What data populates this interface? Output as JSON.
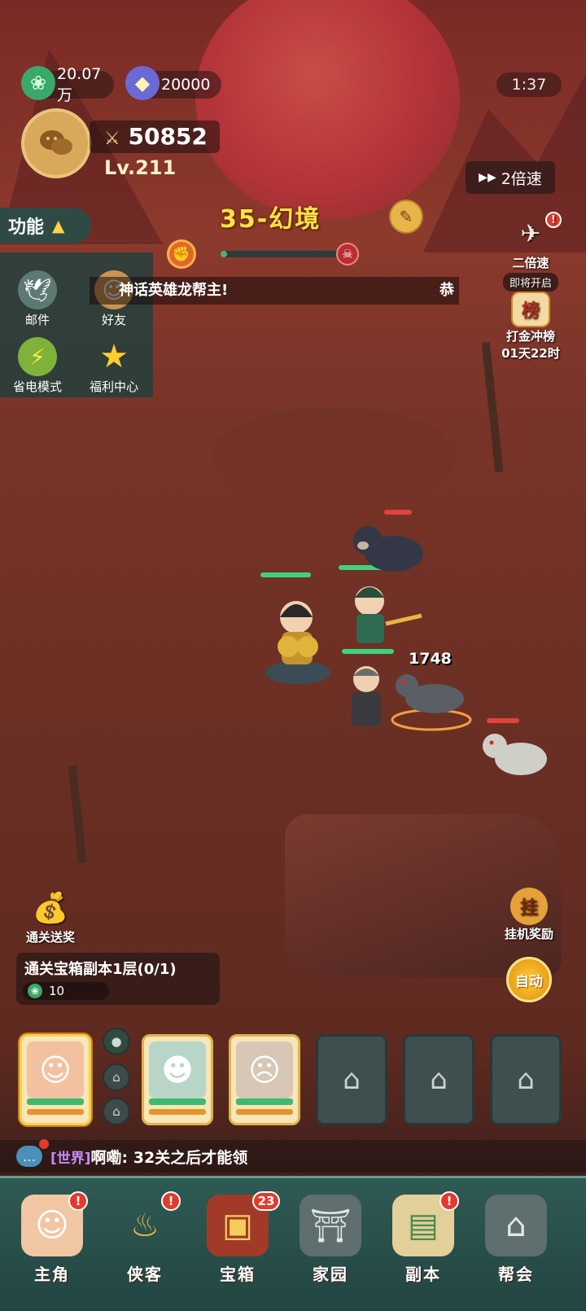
{
  "hud": {
    "currency1": {
      "icon": "jade-icon",
      "value": "20.07万"
    },
    "currency2": {
      "icon": "gem-icon",
      "value": "20000"
    },
    "timer": "1:37",
    "power": "50852",
    "level": "Lv.211",
    "speed_button": "2倍速"
  },
  "stage": {
    "title": "35-幻境",
    "progress": 0.05
  },
  "function_panel": {
    "tab_label": "功能",
    "items": [
      {
        "label": "邮件",
        "icon": "mail-icon"
      },
      {
        "label": "好友",
        "icon": "friend-icon"
      },
      {
        "label": "省电模式",
        "icon": "power-save-icon"
      },
      {
        "label": "福利中心",
        "icon": "star-icon"
      }
    ]
  },
  "marquee": {
    "text": "神话英雄龙帮主!",
    "tail": "恭"
  },
  "side": {
    "double_speed": {
      "label": "二倍速",
      "note": "即将开启"
    },
    "ranking": {
      "label": "打金冲榜",
      "timer": "01天22时",
      "icon_char": "榜"
    },
    "clear_reward": {
      "label": "通关送奖"
    },
    "idle_reward": {
      "label": "挂机奖励",
      "icon_char": "挂"
    }
  },
  "battle": {
    "damage_number": "1748"
  },
  "quest": {
    "title": "通关宝箱副本1层(0/1)",
    "reward": "10"
  },
  "auto_button": "自动",
  "chat": {
    "channel": "[世界]",
    "sender": "啊嘞:",
    "message": "32关之后才能领"
  },
  "nav": {
    "items": [
      {
        "label": "主角",
        "icon": "hero-icon",
        "badge": "!"
      },
      {
        "label": "侠客",
        "icon": "gourd-icon",
        "badge": "!"
      },
      {
        "label": "宝箱",
        "icon": "treasure-chest-icon",
        "badge": "23"
      },
      {
        "label": "家园",
        "icon": "home-gate-icon",
        "badge": ""
      },
      {
        "label": "副本",
        "icon": "scroll-map-icon",
        "badge": "!"
      },
      {
        "label": "帮会",
        "icon": "guild-icon",
        "badge": ""
      }
    ]
  },
  "colors": {
    "accent_gold": "#ffe04a",
    "hp_green": "#3fd27c",
    "hp_red": "#e0443a",
    "nav_bg": "#2f5a54",
    "badge_red": "#e23b2e"
  }
}
